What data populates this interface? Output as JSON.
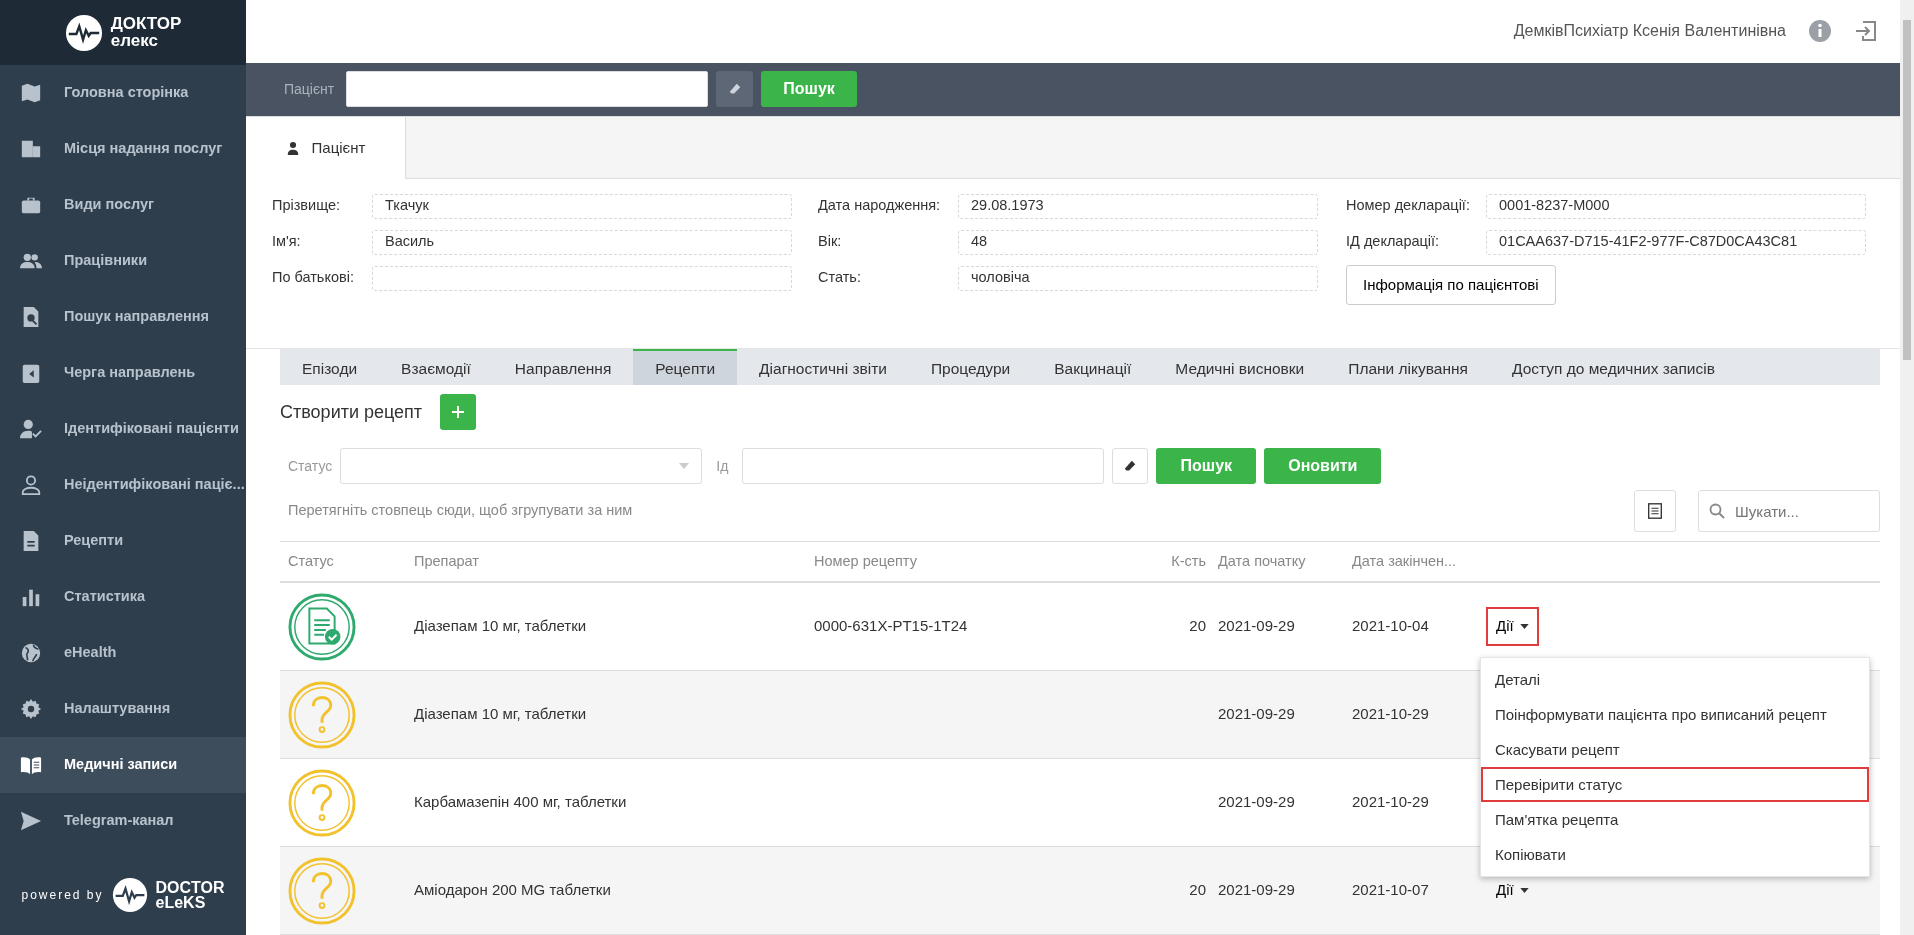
{
  "logo": {
    "line1": "ДОКТОР",
    "line2": "елекс"
  },
  "sidebar": {
    "items": [
      {
        "label": "Головна сторінка",
        "selected": false
      },
      {
        "label": "Місця надання послуг",
        "selected": false
      },
      {
        "label": "Види послуг",
        "selected": false
      },
      {
        "label": "Працівники",
        "selected": false
      },
      {
        "label": "Пошук направлення",
        "selected": false
      },
      {
        "label": "Черга направлень",
        "selected": false
      },
      {
        "label": "Ідентифіковані пацієнти",
        "selected": false
      },
      {
        "label": "Неідентифіковані паціє...",
        "selected": false
      },
      {
        "label": "Рецепти",
        "selected": false
      },
      {
        "label": "Статистика",
        "selected": false
      },
      {
        "label": "eHealth",
        "selected": false
      },
      {
        "label": "Налаштування",
        "selected": false
      },
      {
        "label": "Медичні записи",
        "selected": true
      },
      {
        "label": "Telegram-канал",
        "selected": false
      }
    ],
    "footer": {
      "powered": "powered by",
      "brand1": "DOCTOR",
      "brand2": "eLeKS"
    }
  },
  "header": {
    "user": "ДемківПсихіатр Ксенія Валентинівна"
  },
  "patient_search": {
    "label": "Пацієнт",
    "button": "Пошук"
  },
  "patient_tabs": [
    {
      "label": "Пацієнт",
      "selected": true
    }
  ],
  "patient_fields": [
    [
      {
        "label": "Прізвище:",
        "value": "Ткачук"
      },
      {
        "label": "Ім'я:",
        "value": "Василь"
      },
      {
        "label": "По батькові:"
      }
    ],
    [
      {
        "label": "Дата народження:",
        "value": "29.08.1973"
      },
      {
        "label": "Вік:",
        "value": "48"
      },
      {
        "label": "Стать:",
        "value": "чоловіча"
      }
    ],
    [
      {
        "label": "Номер декларації:",
        "value": "0001-8237-M000"
      },
      {
        "label": "ІД декларації:",
        "value": "01CAA637-D715-41F2-977F-C87D0CA43C81"
      }
    ]
  ],
  "info_button": "Інформація по пацієнтові",
  "record_tabs": [
    {
      "label": "Епізоди",
      "selected": false
    },
    {
      "label": "Взаємодії",
      "selected": false
    },
    {
      "label": "Направлення",
      "selected": false
    },
    {
      "label": "Рецепти",
      "selected": true
    },
    {
      "label": "Діагностичні звіти",
      "selected": false
    },
    {
      "label": "Процедури",
      "selected": false
    },
    {
      "label": "Вакцинації",
      "selected": false
    },
    {
      "label": "Медичні висновки",
      "selected": false
    },
    {
      "label": "Плани лікування",
      "selected": false
    },
    {
      "label": "Доступ до медичних записів",
      "selected": false
    }
  ],
  "create_label": "Створити рецепт",
  "filters": {
    "status_label": "Статус",
    "id_label": "Ід",
    "search_button": "Пошук",
    "refresh_button": "Оновити"
  },
  "group_hint": "Перетягніть стовпець сюди, щоб згрупувати за ним",
  "grid_search": {
    "placeholder": "Шукати..."
  },
  "table": {
    "columns": [
      "Статус",
      "Препарат",
      "Номер рецепту",
      "К-сть",
      "Дата початку",
      "Дата закінчен..."
    ],
    "rows": [
      {
        "kind": "signed",
        "drug": "Діазепам 10 мг, таблетки",
        "number": "0000-631X-PT15-1T24",
        "count": "20",
        "start": "2021-09-29",
        "end": "2021-10-04",
        "action": "Дії",
        "action_highlighted": true
      },
      {
        "kind": "pending",
        "drug": "Діазепам 10 мг, таблетки",
        "start": "2021-09-29",
        "end": "2021-10-29"
      },
      {
        "kind": "pending",
        "drug": "Карбамазепін 400 мг, таблетки",
        "start": "2021-09-29",
        "end": "2021-10-29"
      },
      {
        "kind": "pending",
        "drug": "Аміодарон 200 MG таблетки",
        "count": "20",
        "start": "2021-09-29",
        "end": "2021-10-07",
        "action": "Дії",
        "action_highlighted": false
      }
    ]
  },
  "action_menu": {
    "items": [
      {
        "label": "Деталі",
        "highlighted": false
      },
      {
        "label": "Поінформувати пацієнта про виписаний рецепт",
        "highlighted": false
      },
      {
        "label": "Скасувати рецепт",
        "highlighted": false
      },
      {
        "label": "Перевірити статус",
        "highlighted": true
      },
      {
        "label": "Пам'ятка рецепта",
        "highlighted": false
      },
      {
        "label": "Копіювати",
        "highlighted": false
      }
    ]
  }
}
